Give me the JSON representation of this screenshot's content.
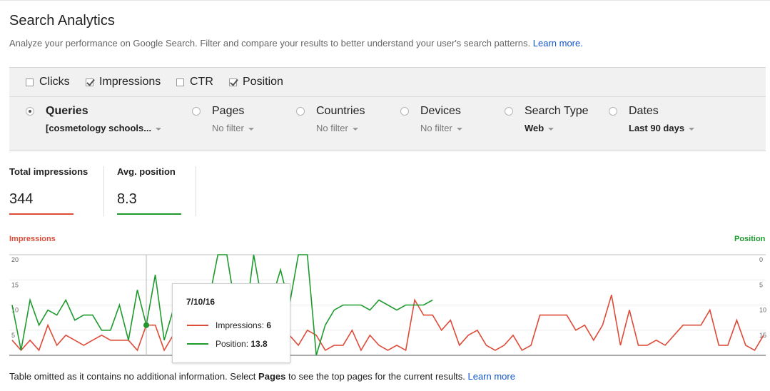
{
  "header": {
    "title": "Search Analytics",
    "subtitle": "Analyze your performance on Google Search. Filter and compare your results to better understand your user's search patterns.",
    "learn_more": "Learn more."
  },
  "metrics": [
    {
      "label": "Clicks",
      "checked": false
    },
    {
      "label": "Impressions",
      "checked": true
    },
    {
      "label": "CTR",
      "checked": false
    },
    {
      "label": "Position",
      "checked": true
    }
  ],
  "dimensions": [
    {
      "label": "Queries",
      "value": "[cosmetology schools...",
      "selected": true
    },
    {
      "label": "Pages",
      "value": "No filter",
      "selected": false
    },
    {
      "label": "Countries",
      "value": "No filter",
      "selected": false
    },
    {
      "label": "Devices",
      "value": "No filter",
      "selected": false
    },
    {
      "label": "Search Type",
      "value": "Web",
      "selected": false
    },
    {
      "label": "Dates",
      "value": "Last 90 days",
      "selected": false
    }
  ],
  "stats": {
    "impressions": {
      "label": "Total impressions",
      "value": "344"
    },
    "position": {
      "label": "Avg. position",
      "value": "8.3"
    }
  },
  "colors": {
    "impressions": "#dd4b39",
    "position": "#1f9a2e",
    "link": "#1155cc"
  },
  "tooltip": {
    "date": "7/10/16",
    "impressions_label": "Impressions:",
    "impressions_value": "6",
    "position_label": "Position:",
    "position_value": "13.8"
  },
  "footer": {
    "prefix": "Table omitted as it contains no additional information. Select",
    "bold": "Pages",
    "suffix": "to see the top pages for the current results.",
    "link": "Learn more"
  },
  "chart_data": {
    "type": "line",
    "left_axis_title": "Impressions",
    "right_axis_title": "Position",
    "left_ticks": [
      "20",
      "15",
      "10",
      "5"
    ],
    "right_ticks": [
      "0",
      "5",
      "10",
      "15"
    ],
    "left_ylim": [
      0,
      20
    ],
    "right_ylim": [
      0,
      20
    ],
    "right_inverted": true,
    "grid": true,
    "series": [
      {
        "name": "Impressions",
        "axis": "left",
        "values": [
          3,
          1,
          3,
          1,
          6,
          2,
          4,
          3,
          2,
          3,
          4,
          3,
          3,
          3,
          1,
          6,
          6,
          1,
          4,
          3,
          4,
          2,
          3,
          1,
          4,
          1,
          5,
          1,
          2,
          1,
          5,
          4,
          2,
          5,
          4,
          1,
          2,
          2,
          5,
          1,
          4,
          2,
          1,
          2,
          1,
          11,
          8,
          8,
          5,
          7,
          2,
          4,
          5,
          2,
          1,
          2,
          4,
          1,
          2,
          8,
          8,
          8,
          8,
          5,
          6,
          3,
          6,
          12,
          2,
          9,
          2,
          2,
          3,
          2,
          4,
          6,
          6,
          6,
          9,
          2,
          2,
          7,
          2,
          1,
          4
        ]
      },
      {
        "name": "Position",
        "axis": "right",
        "values": [
          10,
          19,
          9,
          14,
          11,
          12,
          9,
          13,
          12,
          12,
          15,
          15,
          10,
          17,
          7,
          14,
          4,
          17,
          11,
          13,
          10,
          12,
          9,
          0,
          0,
          11,
          14,
          0,
          10,
          9,
          3,
          10,
          0,
          0,
          20,
          14,
          11,
          10,
          10,
          10,
          11,
          9,
          10,
          11,
          10,
          10,
          10,
          9,
          0,
          0,
          0,
          0,
          20,
          20,
          20,
          0,
          0,
          0,
          0,
          0,
          0,
          0,
          0,
          0,
          0,
          0,
          0,
          0,
          0,
          0,
          0,
          0,
          0,
          0,
          0,
          0,
          0,
          0,
          0,
          0,
          0,
          0,
          0,
          0,
          0
        ],
        "valid": [
          1,
          1,
          1,
          1,
          1,
          1,
          1,
          1,
          1,
          1,
          1,
          1,
          1,
          1,
          1,
          1,
          1,
          1,
          1,
          1,
          1,
          1,
          1,
          1,
          1,
          1,
          1,
          1,
          1,
          1,
          1,
          1,
          1,
          1,
          1,
          1,
          1,
          1,
          1,
          1,
          1,
          1,
          1,
          1,
          1,
          1,
          1,
          1,
          0,
          0,
          0,
          0,
          0,
          0,
          0,
          0,
          0,
          0,
          0,
          0,
          0,
          0,
          0,
          0,
          0,
          0,
          0,
          0,
          0,
          0,
          0,
          0,
          0,
          0,
          0,
          0,
          0,
          0,
          0,
          0,
          0,
          0,
          0,
          0,
          0
        ]
      }
    ]
  }
}
